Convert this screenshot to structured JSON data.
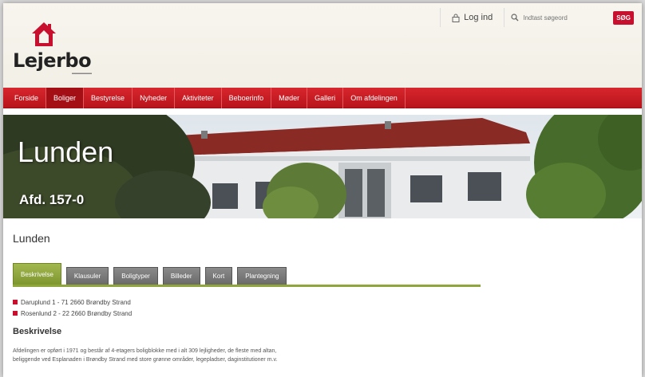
{
  "header": {
    "logo_text": "Lejerbo",
    "login_label": "Log ind",
    "search_placeholder": "Indtast søgeord",
    "search_button": "SØG"
  },
  "nav": {
    "items": [
      {
        "label": "Forside"
      },
      {
        "label": "Boliger",
        "active": true
      },
      {
        "label": "Bestyrelse"
      },
      {
        "label": "Nyheder"
      },
      {
        "label": "Aktiviteter"
      },
      {
        "label": "Beboerinfo"
      },
      {
        "label": "Møder"
      },
      {
        "label": "Galleri"
      },
      {
        "label": "Om afdelingen"
      }
    ]
  },
  "hero": {
    "title": "Lunden",
    "subtitle": "Afd. 157-0"
  },
  "main": {
    "page_title": "Lunden",
    "tabs": [
      {
        "label": "Beskrivelse",
        "active": true
      },
      {
        "label": "Klausuler"
      },
      {
        "label": "Boligtyper"
      },
      {
        "label": "Billeder"
      },
      {
        "label": "Kort"
      },
      {
        "label": "Plantegning"
      }
    ],
    "addresses": [
      "Daruplund 1 - 71 2660 Brøndby Strand",
      "Rosenlund 2 - 22 2660 Brøndby Strand"
    ],
    "section_heading": "Beskrivelse",
    "description_line1": "Afdelingen er opført i 1971 og består af 4-etagers boligblokke med i alt 309 lejligheder, de fleste med altan,",
    "description_line2": "beliggende ved Esplanaden i Brøndby Strand med store grønne områder, legepladser, daginstitutioner m.v."
  },
  "colors": {
    "brand_red": "#c8102e",
    "tab_green": "#8fa63c",
    "tab_gray": "#777777"
  }
}
